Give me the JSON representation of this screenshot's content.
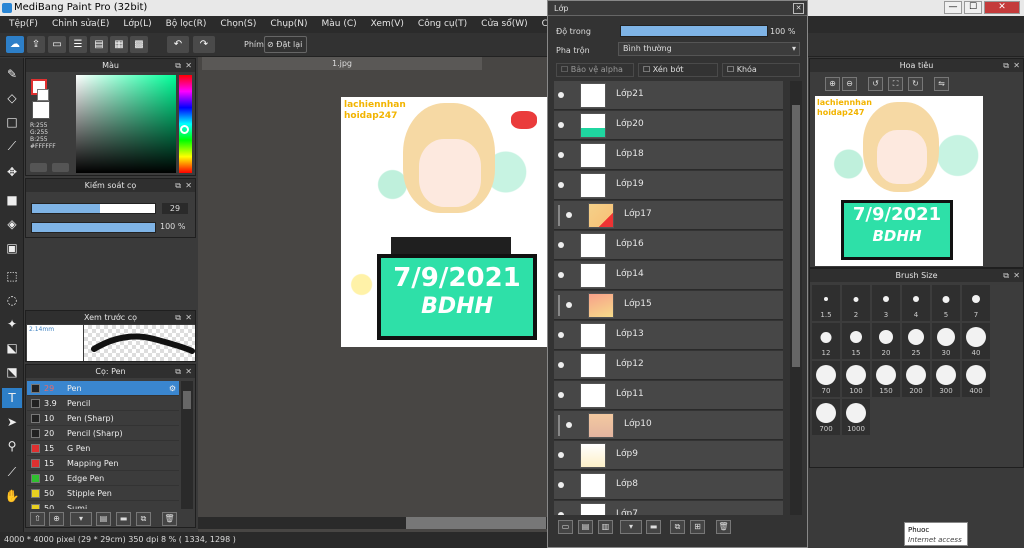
{
  "window": {
    "title": "MediBang Paint Pro (32bit)",
    "min": "—",
    "max": "☐",
    "close": "✕"
  },
  "menu": [
    "Tệp(F)",
    "Chỉnh sửa(E)",
    "Lớp(L)",
    "Bộ lọc(R)",
    "Chọn(S)",
    "Chụp(N)",
    "Màu (C)",
    "Xem(V)",
    "Công cụ(T)",
    "Cửa sổ(W)",
    "Cloud",
    "Help"
  ],
  "toolbar": {
    "undo": "↶",
    "redo": "↷",
    "key_label": "Phím",
    "reset_label": "Đặt lại"
  },
  "color_panel": {
    "title": "Màu",
    "r": "R:255",
    "g": "G:255",
    "b": "B:255",
    "hex": "#FFFFFF"
  },
  "brush_control": {
    "title": "Kiểm soát cọ",
    "size": "29",
    "opacity": "100 %"
  },
  "brush_preview": {
    "title": "Xem trước cọ",
    "size_text": "2.14mm"
  },
  "brush_list": {
    "title": "Cọ: Pen",
    "items": [
      {
        "size": "29",
        "name": "Pen",
        "color": "#222222"
      },
      {
        "size": "3.9",
        "name": "Pencil",
        "color": "#222222"
      },
      {
        "size": "10",
        "name": "Pen (Sharp)",
        "color": "#222222"
      },
      {
        "size": "20",
        "name": "Pencil (Sharp)",
        "color": "#222222"
      },
      {
        "size": "15",
        "name": "G Pen",
        "color": "#e03030"
      },
      {
        "size": "15",
        "name": "Mapping Pen",
        "color": "#e03030"
      },
      {
        "size": "10",
        "name": "Edge Pen",
        "color": "#30c030"
      },
      {
        "size": "50",
        "name": "Stipple Pen",
        "color": "#e8d020"
      },
      {
        "size": "50",
        "name": "Sumi",
        "color": "#e8d020"
      }
    ]
  },
  "canvas": {
    "tab": "1.jpg",
    "watermark": "lachiennhan\nhoidap247",
    "sign_top": "7/9/2021",
    "sign_bottom": "BDHH"
  },
  "layer_panel": {
    "title": "Lớp",
    "opacity_label": "Độ trong",
    "opacity_value": "100 %",
    "blend_label": "Pha trộn",
    "blend_value": "Bình thường",
    "protect_alpha": "Bảo vệ alpha",
    "clipping": "Xén bớt",
    "lock": "Khóa",
    "layers": [
      {
        "name": "Lớp21",
        "indent": false
      },
      {
        "name": "Lớp20",
        "indent": false
      },
      {
        "name": "Lớp18",
        "indent": false
      },
      {
        "name": "Lớp19",
        "indent": false
      },
      {
        "name": "Lớp17",
        "indent": true
      },
      {
        "name": "Lớp16",
        "indent": false
      },
      {
        "name": "Lớp14",
        "indent": false
      },
      {
        "name": "Lớp15",
        "indent": true
      },
      {
        "name": "Lớp13",
        "indent": false
      },
      {
        "name": "Lớp12",
        "indent": false
      },
      {
        "name": "Lớp11",
        "indent": false
      },
      {
        "name": "Lớp10",
        "indent": true
      },
      {
        "name": "Lớp9",
        "indent": false
      },
      {
        "name": "Lớp8",
        "indent": false
      },
      {
        "name": "Lớp7",
        "indent": false
      }
    ]
  },
  "navigator": {
    "title": "Hoa tiêu"
  },
  "brush_size": {
    "title": "Brush Size",
    "sizes": [
      "1.5",
      "2",
      "3",
      "4",
      "5",
      "7",
      "12",
      "15",
      "20",
      "25",
      "30",
      "40",
      "70",
      "100",
      "150",
      "200",
      "300",
      "400",
      "700",
      "1000"
    ]
  },
  "status": {
    "text": "4000 * 4000 pixel  (29 * 29cm)  350 dpi  8 %  ( 1334, 1298 )"
  },
  "tooltip": {
    "name": "Phuoc",
    "status": "Internet access"
  }
}
